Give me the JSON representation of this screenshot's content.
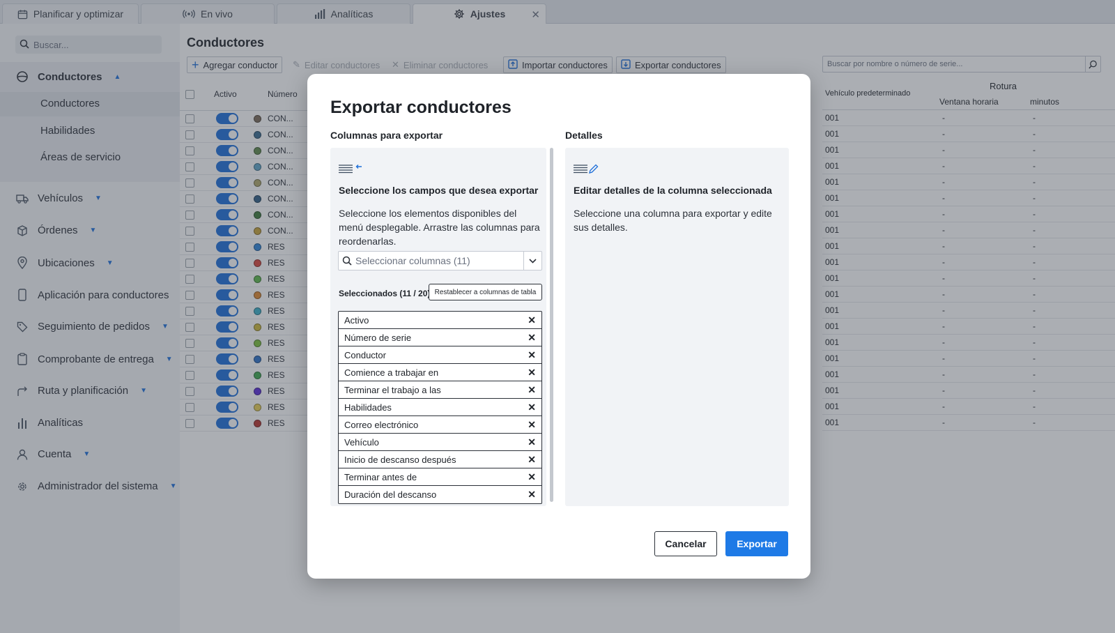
{
  "tabs": [
    {
      "label": "Planificar y optimizar",
      "icon": "calendar-icon"
    },
    {
      "label": "En vivo",
      "icon": "broadcast-icon"
    },
    {
      "label": "Analíticas",
      "icon": "bar-chart-icon"
    },
    {
      "label": "Ajustes",
      "icon": "gear-icon",
      "active": true
    }
  ],
  "sidebar": {
    "search_placeholder": "Buscar...",
    "items": [
      {
        "label": "Conductores",
        "icon": "steering-wheel-icon",
        "caret": "▲"
      },
      {
        "label": "Vehículos",
        "icon": "truck-icon",
        "caret": "▼"
      },
      {
        "label": "Órdenes",
        "icon": "box-icon",
        "caret": "▼"
      },
      {
        "label": "Ubicaciones",
        "icon": "map-pin-icon",
        "caret": "▼"
      },
      {
        "label": "Aplicación para conductores",
        "icon": "phone-icon",
        "caret": "▼"
      },
      {
        "label": "Seguimiento de pedidos",
        "icon": "tag-icon",
        "caret": "▼"
      },
      {
        "label": "Comprobante de entrega",
        "icon": "clipboard-icon",
        "caret": "▼"
      },
      {
        "label": "Ruta y planificación",
        "icon": "route-arrow-icon",
        "caret": "▼"
      },
      {
        "label": "Analíticas",
        "icon": "bar-chart-icon",
        "caret": ""
      },
      {
        "label": "Cuenta",
        "icon": "user-icon",
        "caret": "▼"
      },
      {
        "label": "Administrador del sistema",
        "icon": "gear-icon",
        "caret": "▼"
      }
    ],
    "subitems": [
      "Conductores",
      "Habilidades",
      "Áreas de servicio"
    ]
  },
  "main": {
    "title": "Conductores",
    "toolbar": {
      "add": "Agregar conductor",
      "edit": "Editar conductores",
      "delete": "Eliminar conductores",
      "import": "Importar conductores",
      "export": "Exportar conductores"
    },
    "serial_search_placeholder": "Buscar por nombre o número de serie...",
    "table": {
      "col_active": "Activo",
      "col_number": "Número",
      "col_vehicle": "Vehículo predeterminado",
      "col_break": "Rotura",
      "col_window": "Ventana horaria",
      "col_minutes": "minutos",
      "rows": [
        {
          "color": "#7a6a58",
          "code": "CON...",
          "vehicle": "001",
          "window": "-",
          "minutes": "-"
        },
        {
          "color": "#3a6c8f",
          "code": "CON...",
          "vehicle": "001",
          "window": "-",
          "minutes": "-"
        },
        {
          "color": "#5f8a4c",
          "code": "CON...",
          "vehicle": "001",
          "window": "-",
          "minutes": "-"
        },
        {
          "color": "#5fa6c8",
          "code": "CON...",
          "vehicle": "001",
          "window": "-",
          "minutes": "-"
        },
        {
          "color": "#b0a86a",
          "code": "CON...",
          "vehicle": "001",
          "window": "-",
          "minutes": "-"
        },
        {
          "color": "#2f5e86",
          "code": "CON...",
          "vehicle": "001",
          "window": "-",
          "minutes": "-"
        },
        {
          "color": "#3f7a3c",
          "code": "CON...",
          "vehicle": "001",
          "window": "-",
          "minutes": "-"
        },
        {
          "color": "#c9a43a",
          "code": "CON...",
          "vehicle": "001",
          "window": "-",
          "minutes": "-"
        },
        {
          "color": "#2f86d9",
          "code": "RES",
          "vehicle": "001",
          "window": "-",
          "minutes": "-"
        },
        {
          "color": "#d9453b",
          "code": "RES",
          "vehicle": "001",
          "window": "-",
          "minutes": "-"
        },
        {
          "color": "#5db84a",
          "code": "RES",
          "vehicle": "001",
          "window": "-",
          "minutes": "-"
        },
        {
          "color": "#e0892f",
          "code": "RES",
          "vehicle": "001",
          "window": "-",
          "minutes": "-"
        },
        {
          "color": "#3bb0c9",
          "code": "RES",
          "vehicle": "001",
          "window": "-",
          "minutes": "-"
        },
        {
          "color": "#cdb83a",
          "code": "RES",
          "vehicle": "001",
          "window": "-",
          "minutes": "-"
        },
        {
          "color": "#7cc23a",
          "code": "RES",
          "vehicle": "001",
          "window": "-",
          "minutes": "-"
        },
        {
          "color": "#2d72c9",
          "code": "RES",
          "vehicle": "001",
          "window": "-",
          "minutes": "-"
        },
        {
          "color": "#3faa4f",
          "code": "RES",
          "vehicle": "001",
          "window": "-",
          "minutes": "-"
        },
        {
          "color": "#5b2bd9",
          "code": "RES",
          "vehicle": "001",
          "window": "-",
          "minutes": "-"
        },
        {
          "color": "#e8cf55",
          "code": "RES",
          "vehicle": "001",
          "window": "-",
          "minutes": "-"
        },
        {
          "color": "#b8352e",
          "code": "RES",
          "vehicle": "001",
          "window": "-",
          "minutes": "-"
        }
      ]
    }
  },
  "dialog": {
    "title": "Exportar conductores",
    "left_label": "Columnas para exportar",
    "right_label": "Detalles",
    "left_heading": "Seleccione los campos que desea exportar",
    "left_text": "Seleccione los elementos disponibles del menú desplegable. Arrastre las columnas para reordenarlas.",
    "select_placeholder": "Seleccionar columnas (11)",
    "selected_count": "Seleccionados (11 / 20)",
    "reset_label": "Restablecer a columnas de tabla",
    "columns": [
      "Activo",
      "Número de serie",
      "Conductor",
      "Comience a trabajar en",
      "Terminar el trabajo a las",
      "Habilidades",
      "Correo electrónico",
      "Vehículo",
      "Inicio de descanso después",
      "Terminar antes de",
      "Duración del descanso"
    ],
    "right_heading": "Editar detalles de la columna seleccionada",
    "right_text": "Seleccione una columna para exportar y edite sus detalles.",
    "cancel_label": "Cancelar",
    "export_label": "Exportar"
  },
  "colors": {
    "accent": "#1e7ae6",
    "toggle_on": "#1e6fd9"
  }
}
